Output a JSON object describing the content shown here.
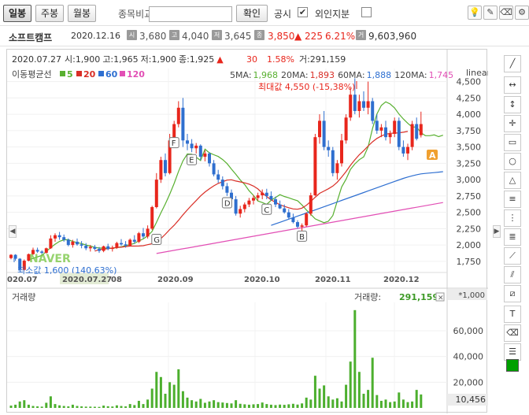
{
  "toolbar": {
    "tabs": [
      "일봉",
      "주봉",
      "월봉"
    ],
    "compare_label": "종목비교",
    "compare_value": "",
    "confirm_label": "확인",
    "notice_label": "공시",
    "notice_checked": "✔",
    "foreign_label": "외인지분",
    "foreign_checked": ""
  },
  "stock": {
    "name": "소프트캠프",
    "date": "2020.12.16",
    "open_tag": "시",
    "open": "3,680",
    "high_tag": "고",
    "high": "4,040",
    "low_tag": "저",
    "low": "3,645",
    "close_tag": "종",
    "close": "3,850",
    "change": "▲ 225",
    "change_pct": "6.21%",
    "volume_tag": "거",
    "volume": "9,603,960"
  },
  "crosshair": {
    "date": "2020.07.27",
    "open_label": "시:",
    "open": "1,900",
    "high_label": "고:",
    "high": "1,965",
    "low_label": "저:",
    "low": "1,900",
    "close_label": "종:",
    "close": "1,925",
    "arrow": "▲",
    "change": "30",
    "pct": "1.58%",
    "vol_label": "거:",
    "vol": "291,159"
  },
  "ma_legend": {
    "title": "이동평균선",
    "periods": [
      "5",
      "20",
      "60",
      "120"
    ],
    "values": [
      {
        "label": "5MA:",
        "value": "1,968"
      },
      {
        "label": "20MA:",
        "value": "1,893"
      },
      {
        "label": "60MA:",
        "value": "1,888"
      },
      {
        "label": "120MA:",
        "value": "1,745"
      }
    ]
  },
  "scale_label": "linear",
  "annotations": {
    "max": "최대값 4,550 (-15,38%)",
    "min": "최소값 1,600 (140,63%)",
    "watermark": "NAVER",
    "letters": [
      "G",
      "F",
      "E",
      "D",
      "C",
      "B"
    ],
    "current_marker": "A"
  },
  "volume_panel": {
    "title": "거래량",
    "legend_label": "거래량:",
    "legend_value": "291,159",
    "close_icon": "✕",
    "unit": "*1,000",
    "current": "10,456"
  },
  "x_axis": {
    "edge_left": "020.07",
    "selected": "2020.07.27",
    "after_selected": "08",
    "labels": [
      "2020.09",
      "2020.10",
      "2020.11",
      "2020.12"
    ]
  },
  "colors": {
    "up": "#e8261c",
    "down": "#2f6fcf",
    "ma5": "#58b030",
    "ma20": "#d92e26",
    "ma60": "#2e6fd1",
    "ma120": "#e24fb5",
    "volume": "#4caf2e"
  },
  "chart_data": {
    "type": "candlestick",
    "price_axis": {
      "ticks": [
        1750,
        2000,
        2250,
        2500,
        2750,
        3000,
        3250,
        3500,
        3750,
        4000,
        4250,
        4500
      ],
      "tick_labels": [
        "1,750",
        "2,000",
        "2,250",
        "2,500",
        "2,750",
        "3,000",
        "3,250",
        "3,500",
        "3,750",
        "4,000",
        "4,250",
        "4,500"
      ],
      "range": [
        1580,
        4700
      ]
    },
    "volume_axis": {
      "ticks": [
        20000,
        40000,
        60000
      ],
      "tick_labels": [
        "20,000",
        "40,000",
        "60,000"
      ],
      "range": [
        0,
        82000
      ]
    },
    "candles": [
      [
        1800,
        1860,
        1780,
        1850
      ],
      [
        1850,
        1860,
        1760,
        1790
      ],
      [
        1790,
        1800,
        1600,
        1620
      ],
      [
        1620,
        1780,
        1610,
        1760
      ],
      [
        1760,
        1870,
        1750,
        1860
      ],
      [
        1860,
        1960,
        1850,
        1925
      ],
      [
        1925,
        1960,
        1880,
        1900
      ],
      [
        1900,
        1920,
        1860,
        1880
      ],
      [
        1880,
        1960,
        1870,
        1950
      ],
      [
        1950,
        2150,
        1940,
        2100
      ],
      [
        2100,
        2180,
        2050,
        2150
      ],
      [
        2150,
        2200,
        2080,
        2120
      ],
      [
        2120,
        2160,
        2050,
        2080
      ],
      [
        2080,
        2100,
        1980,
        2000
      ],
      [
        2000,
        2080,
        1960,
        2050
      ],
      [
        2050,
        2100,
        1990,
        2010
      ],
      [
        2010,
        2060,
        1950,
        1990
      ],
      [
        1990,
        2030,
        1920,
        1950
      ],
      [
        1950,
        2000,
        1900,
        1970
      ],
      [
        1970,
        2000,
        1920,
        1940
      ],
      [
        1940,
        1970,
        1880,
        1910
      ],
      [
        1910,
        1990,
        1890,
        1980
      ],
      [
        1980,
        2020,
        1920,
        1940
      ],
      [
        1940,
        1990,
        1900,
        1960
      ],
      [
        1960,
        2050,
        1940,
        2030
      ],
      [
        2030,
        2090,
        1990,
        2010
      ],
      [
        2010,
        2060,
        1960,
        1990
      ],
      [
        1990,
        2100,
        1980,
        2080
      ],
      [
        2080,
        2150,
        2020,
        2050
      ],
      [
        2050,
        2200,
        2030,
        2180
      ],
      [
        2180,
        2260,
        2100,
        2130
      ],
      [
        2130,
        2300,
        2100,
        2250
      ],
      [
        2250,
        2600,
        2230,
        2580
      ],
      [
        2580,
        3100,
        2560,
        3000
      ],
      [
        3000,
        3350,
        2950,
        3300
      ],
      [
        3300,
        3400,
        3050,
        3100
      ],
      [
        3100,
        3700,
        3080,
        3600
      ],
      [
        3600,
        3900,
        3550,
        3850
      ],
      [
        3850,
        4200,
        3800,
        4100
      ],
      [
        4100,
        4250,
        3500,
        3600
      ],
      [
        3600,
        3700,
        3450,
        3550
      ],
      [
        3550,
        3620,
        3420,
        3480
      ],
      [
        3480,
        3560,
        3400,
        3520
      ],
      [
        3520,
        3540,
        3300,
        3350
      ],
      [
        3350,
        3450,
        3280,
        3400
      ],
      [
        3400,
        3420,
        3200,
        3250
      ],
      [
        3250,
        3300,
        3050,
        3080
      ],
      [
        3080,
        3150,
        2950,
        3000
      ],
      [
        3000,
        3050,
        2850,
        2900
      ],
      [
        2900,
        2950,
        2750,
        2800
      ],
      [
        2800,
        2850,
        2650,
        2700
      ],
      [
        2700,
        2750,
        2450,
        2480
      ],
      [
        2480,
        2600,
        2420,
        2550
      ],
      [
        2550,
        2650,
        2500,
        2620
      ],
      [
        2620,
        2720,
        2580,
        2680
      ],
      [
        2680,
        2760,
        2620,
        2720
      ],
      [
        2720,
        2800,
        2680,
        2760
      ],
      [
        2760,
        2850,
        2700,
        2800
      ],
      [
        2800,
        2860,
        2700,
        2750
      ],
      [
        2750,
        2820,
        2680,
        2700
      ],
      [
        2700,
        2740,
        2580,
        2620
      ],
      [
        2620,
        2680,
        2550,
        2560
      ],
      [
        2560,
        2620,
        2480,
        2500
      ],
      [
        2500,
        2550,
        2400,
        2420
      ],
      [
        2420,
        2480,
        2330,
        2350
      ],
      [
        2350,
        2380,
        2250,
        2280
      ],
      [
        2280,
        2330,
        2200,
        2300
      ],
      [
        2300,
        2500,
        2280,
        2480
      ],
      [
        2480,
        2800,
        2450,
        2760
      ],
      [
        2760,
        3700,
        2750,
        3650
      ],
      [
        3650,
        4000,
        3550,
        3900
      ],
      [
        3900,
        4050,
        3450,
        3500
      ],
      [
        3500,
        3600,
        3350,
        3450
      ],
      [
        3450,
        3500,
        3050,
        3100
      ],
      [
        3100,
        3300,
        3000,
        3250
      ],
      [
        3250,
        3700,
        3200,
        3600
      ],
      [
        3600,
        4000,
        3550,
        3950
      ],
      [
        3950,
        4400,
        3900,
        4300
      ],
      [
        4300,
        4550,
        4000,
        4050
      ],
      [
        4050,
        4300,
        3950,
        4200
      ],
      [
        4200,
        4350,
        4050,
        4100
      ],
      [
        4100,
        4500,
        4000,
        4200
      ],
      [
        4200,
        4250,
        3850,
        3900
      ],
      [
        3900,
        4000,
        3700,
        3750
      ],
      [
        3750,
        3850,
        3650,
        3800
      ],
      [
        3800,
        3900,
        3600,
        3650
      ],
      [
        3650,
        3750,
        3550,
        3700
      ],
      [
        3700,
        3950,
        3650,
        3900
      ],
      [
        3900,
        3950,
        3450,
        3500
      ],
      [
        3500,
        3600,
        3350,
        3400
      ],
      [
        3400,
        3550,
        3300,
        3500
      ],
      [
        3500,
        3900,
        3450,
        3850
      ],
      [
        3850,
        3950,
        3600,
        3625
      ],
      [
        3680,
        4040,
        3645,
        3850
      ]
    ],
    "ma": {
      "5": {
        "start": 4,
        "values": [
          1776,
          1794,
          1818,
          1842,
          1901,
          1961,
          2012,
          2056,
          2080,
          2081,
          2055,
          2037,
          2022,
          2000,
          1984,
          1964,
          1954,
          1954,
          1952,
          1952,
          1960,
          1973,
          1990,
          2006,
          2024,
          2063,
          2093,
          2140,
          2209,
          2348,
          2493,
          2628,
          2777,
          2941,
          3126,
          3287,
          3393,
          3389,
          3344,
          3292,
          3467,
          3410,
          3381,
          3355,
          3307,
          3246,
          3161,
          3081,
          2996,
          2925,
          2830,
          2759,
          2674,
          2650,
          2622,
          2684,
          2727,
          2770,
          2742,
          2722,
          2698,
          2677,
          2612,
          2537,
          2469,
          2400,
          2370,
          2341,
          2364,
          2451,
          2671,
          2888,
          3006,
          3157,
          3241,
          3305,
          3349,
          3500,
          3781,
          4005,
          4135,
          4191,
          4158,
          4098,
          4004,
          3928,
          3862,
          3805,
          3805,
          3717,
          3672,
          3672,
          3684,
          3658,
          3680
        ]
      },
      "20": {
        "start": 19,
        "values": [
          1905,
          1932,
          1937,
          1944,
          1954,
          1962,
          1967,
          1976,
          1983,
          1984,
          1985,
          1990,
          2005,
          2020,
          2052,
          2099,
          2164,
          2237,
          2302,
          2379,
          2462,
          2538,
          2611,
          2680,
          2751,
          2810,
          2859,
          2905,
          2942,
          2968,
          2993,
          2998,
          2979,
          2965,
          2951,
          2932,
          2902,
          2858,
          2794,
          2743,
          2689,
          2655,
          2616,
          2591,
          2570,
          2552,
          2547,
          2564,
          2608,
          2667,
          2731,
          2791,
          2825,
          2860,
          2902,
          2961,
          3039,
          3123,
          3220,
          3304,
          3381,
          3444,
          3513,
          3578,
          3630,
          3668,
          3694,
          3708,
          3712,
          3716,
          3725,
          3738
        ]
      },
      "60": {
        "start": 59,
        "values": [
          2300,
          2324,
          2347,
          2371,
          2395,
          2418,
          2442,
          2466,
          2490,
          2513,
          2537,
          2561,
          2585,
          2609,
          2633,
          2658,
          2682,
          2706,
          2730,
          2755,
          2779,
          2803,
          2828,
          2852,
          2876,
          2900,
          2924,
          2948,
          2972,
          2996,
          3020,
          3040,
          3058,
          3075,
          3088,
          3096,
          3102,
          3108,
          3115,
          3122
        ]
      },
      "120": {
        "start": 33,
        "values": [
          1870,
          1882,
          1894,
          1906,
          1918,
          1930,
          1942,
          1954,
          1966,
          1978,
          1990,
          2002,
          2014,
          2026,
          2038,
          2050,
          2062,
          2074,
          2086,
          2098,
          2110,
          2122,
          2134,
          2146,
          2158,
          2170,
          2182,
          2194,
          2206,
          2218,
          2230,
          2242,
          2254,
          2266,
          2278,
          2290,
          2302,
          2314,
          2326,
          2338,
          2350,
          2362,
          2374,
          2386,
          2398,
          2410,
          2422,
          2434,
          2446,
          2458,
          2470,
          2482,
          2494,
          2506,
          2518,
          2530,
          2542,
          2554,
          2566,
          2578,
          2590,
          2602,
          2614,
          2626,
          2638,
          2650
        ]
      }
    },
    "volume": [
      1800,
      2500,
      5000,
      6000,
      2500,
      1500,
      1200,
      1000,
      4000,
      9000,
      3000,
      2000,
      1500,
      1200,
      2500,
      1500,
      1200,
      1000,
      1000,
      900,
      800,
      1800,
      1300,
      1100,
      2000,
      1500,
      1200,
      3000,
      2200,
      5500,
      3000,
      6500,
      15000,
      28000,
      24000,
      11000,
      20000,
      18000,
      30000,
      13000,
      8000,
      6000,
      5000,
      7000,
      4000,
      5000,
      6000,
      4500,
      4200,
      3800,
      3500,
      6000,
      3200,
      2800,
      2500,
      2800,
      3000,
      4200,
      3000,
      2500,
      2200,
      2600,
      2400,
      2800,
      3200,
      2600,
      3500,
      8000,
      6500,
      25000,
      15000,
      17500,
      9000,
      6500,
      7500,
      5000,
      18000,
      36000,
      76000,
      28000,
      11000,
      14000,
      39000,
      10000,
      5500,
      6500,
      4500,
      5000,
      12000,
      6500,
      4500,
      5000,
      14000,
      10456,
      10456
    ]
  }
}
